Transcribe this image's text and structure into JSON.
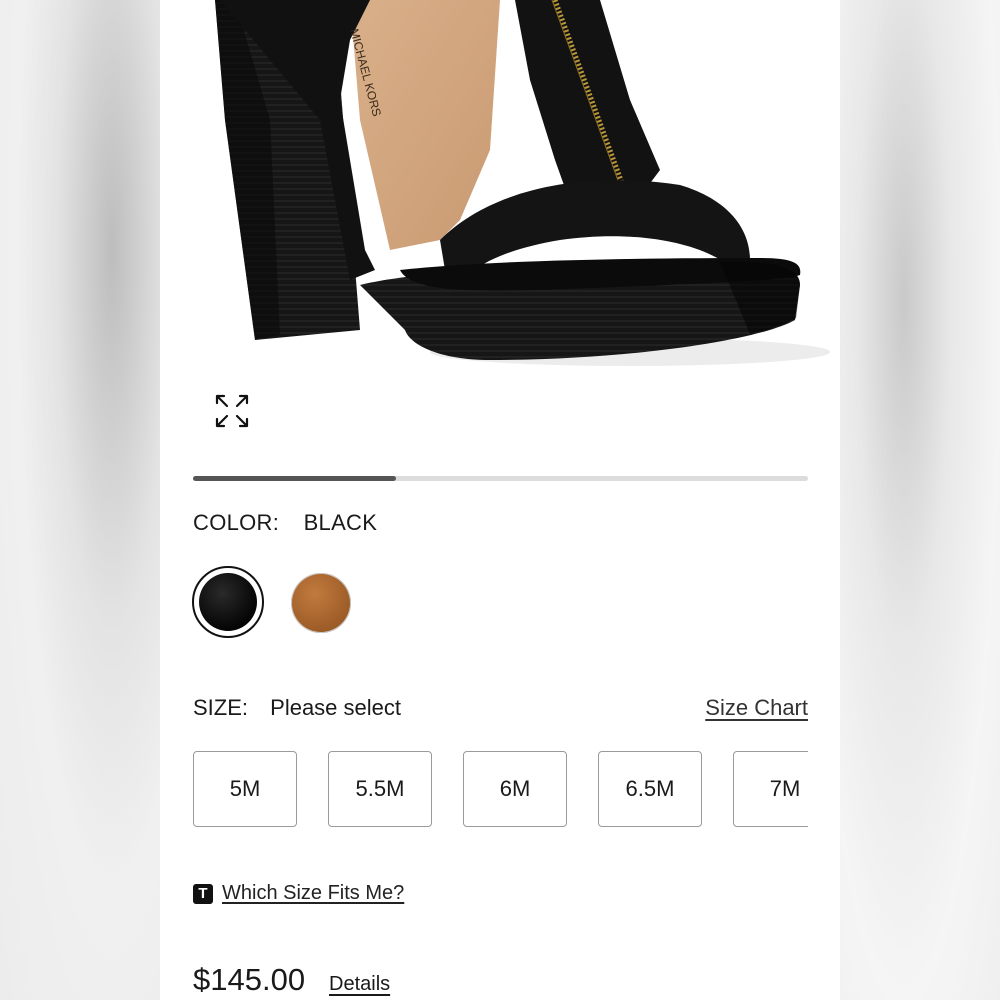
{
  "gallery": {
    "progress_fraction": 0.33,
    "brand_mark": "MICHAEL KORS"
  },
  "color": {
    "label": "COLOR:",
    "selected": "BLACK",
    "swatches": [
      {
        "name": "Black",
        "hex": "#0b0b0b",
        "selected": true
      },
      {
        "name": "Brown",
        "hex": "#a8652c",
        "selected": false
      }
    ]
  },
  "size": {
    "label": "SIZE:",
    "value": "Please select",
    "chart_link": "Size Chart",
    "options": [
      "5M",
      "5.5M",
      "6M",
      "6.5M",
      "7M"
    ]
  },
  "fit": {
    "badge": "T",
    "link": "Which Size Fits Me?"
  },
  "price": {
    "amount": "$145.00",
    "details_link": "Details"
  },
  "icons": {
    "expand": "expand-arrows-icon"
  }
}
